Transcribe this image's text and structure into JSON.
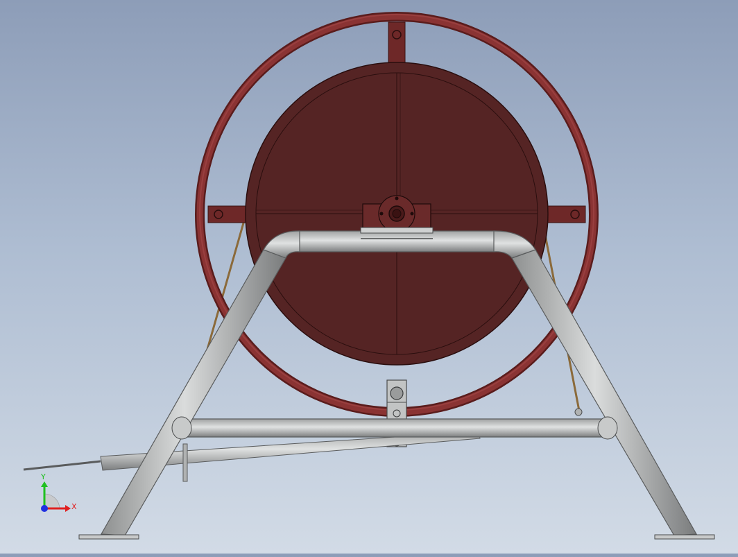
{
  "triad": {
    "x_label": "X",
    "y_label": "Y"
  },
  "colors": {
    "drum_face": "#552424",
    "drum_edge": "#3a1414",
    "wheel_ring": "#7e2d2d",
    "frame_tube": "#b3b5b5",
    "frame_dark": "#6b6d6e",
    "brace_wire": "#8b6a3a",
    "axis_x": "#e02020",
    "axis_y": "#20c020",
    "axis_z": "#2030e0"
  }
}
